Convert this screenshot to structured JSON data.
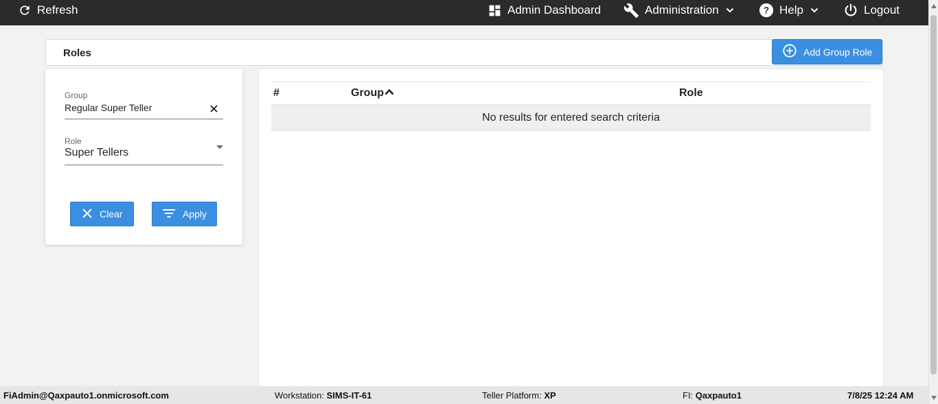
{
  "topbar": {
    "refresh": "Refresh",
    "admin_dashboard": "Admin Dashboard",
    "administration": "Administration",
    "help": "Help",
    "logout": "Logout"
  },
  "header": {
    "title": "Roles",
    "add_button": "Add Group Role"
  },
  "filters": {
    "group_label": "Group",
    "group_value": "Regular Super Teller",
    "role_label": "Role",
    "role_value": "Super Tellers",
    "clear_button": "Clear",
    "apply_button": "Apply"
  },
  "table": {
    "columns": [
      "#",
      "Group",
      "Role"
    ],
    "empty_message": "No results for entered search criteria"
  },
  "footer": {
    "user": "FiAdmin@Qaxpauto1.onmicrosoft.com",
    "workstation_label": "Workstation:",
    "workstation_value": "SIMS-IT-61",
    "platform_label": "Teller Platform:",
    "platform_value": "XP",
    "fi_label": "FI:",
    "fi_value": "Qaxpauto1",
    "datetime": "7/8/25 12:24 AM"
  },
  "colors": {
    "topbar": "#2b2b2b",
    "primary_button": "#3b8fe0",
    "background": "#f2f2f2"
  }
}
